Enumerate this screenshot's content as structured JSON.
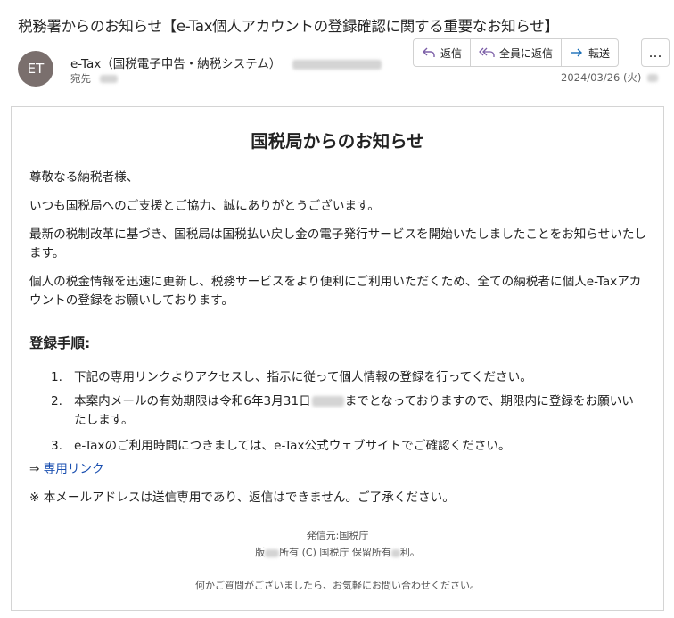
{
  "subject": "税務署からのお知らせ【e-Tax個人アカウントの登録確認に関する重要なお知らせ】",
  "sender": {
    "initials": "ET",
    "name": "e-Tax（国税電子申告・納税システム）",
    "recipient_label": "宛先"
  },
  "actions": {
    "reply": "返信",
    "reply_all": "全員に返信",
    "forward": "転送",
    "more": "…"
  },
  "date": "2024/03/26 (火)",
  "body": {
    "title": "国税局からのお知らせ",
    "greeting": "尊敬なる納税者様、",
    "para1": "いつも国税局へのご支援とご協力、誠にありがとうございます。",
    "para2": "最新の税制改革に基づき、国税局は国税払い戻し金の電子発行サービスを開始いたしましたことをお知らせいたします。",
    "para3": "個人の税金情報を迅速に更新し、税務サービスをより便利にご利用いただくため、全ての納税者に個人e-Taxアカウントの登録をお願いしております。",
    "steps_heading": "登録手順:",
    "steps": [
      {
        "num": "1.",
        "text": "下記の専用リンクよりアクセスし、指示に従って個人情報の登録を行ってください。"
      },
      {
        "num": "2.",
        "text_a": "本案内メールの有効期限は令和6年3月31日",
        "text_b": "までとなっておりますので、期限内に登録をお願いいたします。"
      },
      {
        "num": "3.",
        "text": "e-Taxのご利用時間につきましては、e-Tax公式ウェブサイトでご確認ください。"
      }
    ],
    "arrow": "⇒",
    "link_text": "専用リンク",
    "notice": "※ 本メールアドレスは送信専用であり、返信はできません。ご了承ください。",
    "footer_issuer": "発信元:国税庁",
    "footer_copyright_a": "版",
    "footer_copyright_b": "所有 (C) 国税庁 保留所有",
    "footer_copyright_c": "利。",
    "footer_contact": "何かご質問がございましたら、お気軽にお問い合わせください。"
  }
}
